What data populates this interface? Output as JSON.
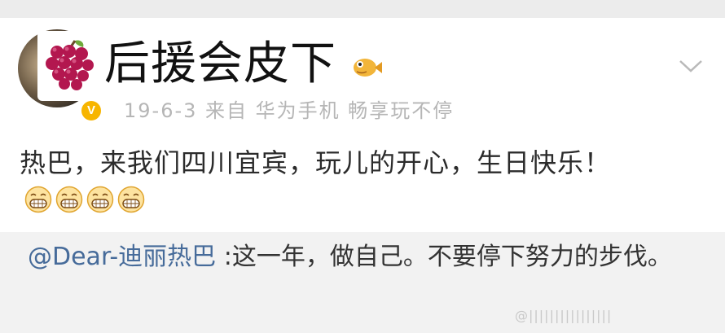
{
  "post": {
    "username": "后援会皮下",
    "meta": "19-6-3 来自 华为手机 畅享玩不停",
    "text": "热巴，来我们四川宜宾，玩儿的开心，生日快乐！",
    "emoji_icons": [
      "grin-icon",
      "grin-icon",
      "grin-icon",
      "grin-icon"
    ],
    "badge": "V"
  },
  "reply": {
    "mention": "@Dear-迪丽热巴",
    "text": " :这一年，做自己。不要停下努力的步伐。"
  },
  "watermark": "@||||||||||||||||",
  "colors": {
    "mention": "#466b9a",
    "meta": "#b6b6b6",
    "badge": "#f7b500"
  }
}
